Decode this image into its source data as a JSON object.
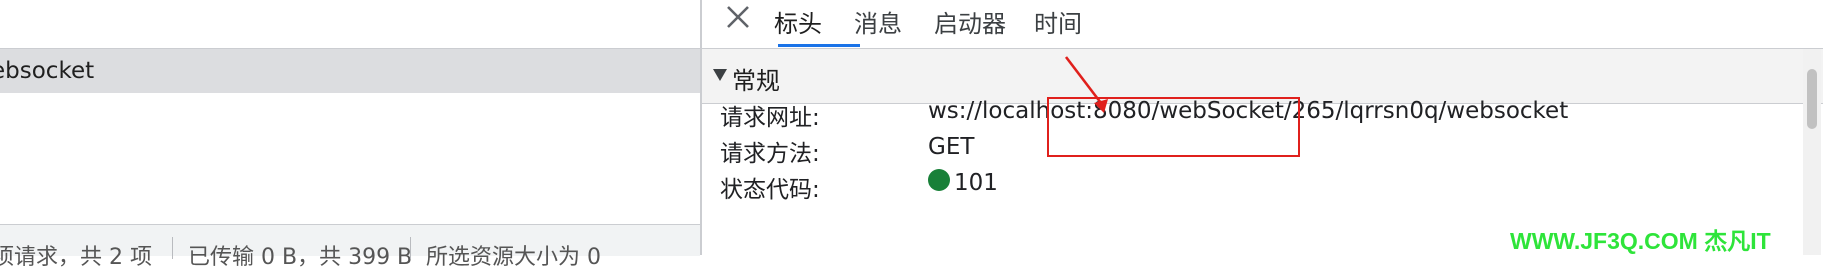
{
  "left": {
    "selected_row": "ebsocket",
    "status": {
      "requests": "项请求，共 2 项",
      "transferred": "已传输 0 B，共 399 B",
      "resources": "所选资源大小为 0"
    }
  },
  "tabs": [
    {
      "label": "标头",
      "active": true
    },
    {
      "label": "消息",
      "active": false
    },
    {
      "label": "启动器",
      "active": false
    },
    {
      "label": "时间",
      "active": false
    }
  ],
  "section": {
    "label": "常规"
  },
  "general": {
    "request_url_label": "请求网址:",
    "request_url": "ws://localhost:8080/webSocket/265/lqrrsn0q/websocket",
    "method_label": "请求方法:",
    "method": "GET",
    "status_label": "状态代码:",
    "status": "101",
    "status_color": "#188038"
  },
  "icons": {
    "close": "close-icon",
    "section_toggle": "triangle-down-icon"
  },
  "accent": "#1a73e8",
  "annotation_color": "#e0201c",
  "watermark": "WWW.JF3Q.COM 杰凡IT"
}
